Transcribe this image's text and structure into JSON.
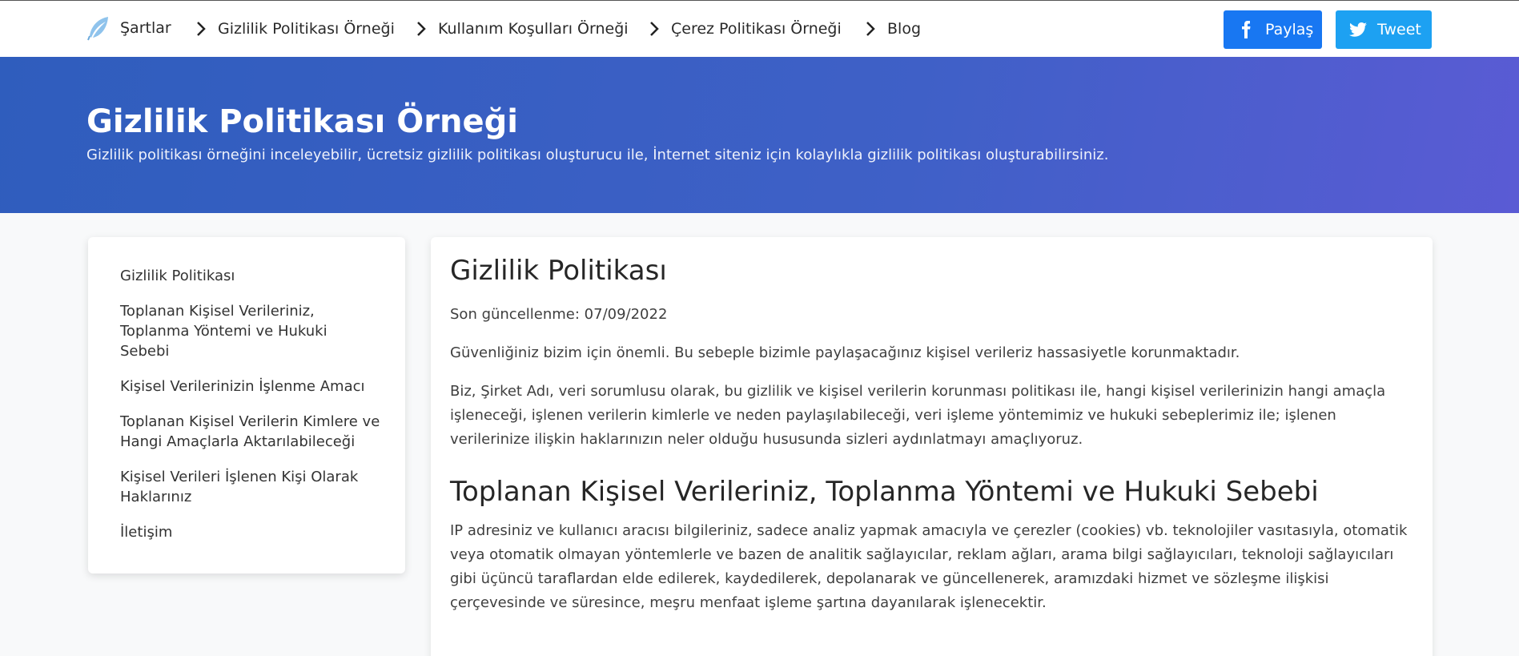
{
  "nav": {
    "brand_label": "Şartlar",
    "brand_icon": "feather-icon",
    "items": [
      {
        "label": "Gizlilik Politikası Örneği"
      },
      {
        "label": "Kullanım Koşulları Örneği"
      },
      {
        "label": "Çerez Politikası Örneği"
      },
      {
        "label": "Blog"
      }
    ],
    "share_facebook": "Paylaş",
    "share_twitter": "Tweet"
  },
  "hero": {
    "title": "Gizlilik Politikası Örneği",
    "subtitle": "Gizlilik politikası örneğini inceleyebilir, ücretsiz gizlilik politikası oluşturucu ile, İnternet siteniz için kolaylıkla gizlilik politikası oluşturabilirsiniz."
  },
  "sidebar": {
    "items": [
      {
        "label": "Gizlilik Politikası"
      },
      {
        "label": "Toplanan Kişisel Verileriniz, Toplanma Yöntemi ve Hukuki Sebebi"
      },
      {
        "label": "Kişisel Verilerinizin İşlenme Amacı"
      },
      {
        "label": "Toplanan Kişisel Verilerin Kimlere ve Hangi Amaçlarla Aktarılabileceği"
      },
      {
        "label": "Kişisel Verileri İşlenen Kişi Olarak Haklarınız"
      },
      {
        "label": "İletişim"
      }
    ]
  },
  "content": {
    "title": "Gizlilik Politikası",
    "updated": "Son güncellenme: 07/09/2022",
    "para1": "Güvenliğiniz bizim için önemli. Bu sebeple bizimle paylaşacağınız kişisel verileriz hassasiyetle korunmaktadır.",
    "para2": "Biz, Şirket Adı, veri sorumlusu olarak, bu gizlilik ve kişisel verilerin korunması politikası ile, hangi kişisel verilerinizin hangi amaçla işleneceği, işlenen verilerin kimlerle ve neden paylaşılabileceği, veri işleme yöntemimiz ve hukuki sebeplerimiz ile; işlenen verilerinize ilişkin haklarınızın neler olduğu hususunda sizleri aydınlatmayı amaçlıyoruz.",
    "section_title": "Toplanan Kişisel Verileriniz, Toplanma Yöntemi ve Hukuki Sebebi",
    "para3": "IP adresiniz ve kullanıcı aracısı bilgileriniz, sadece analiz yapmak amacıyla ve çerezler (cookies) vb. teknolojiler vasıtasıyla, otomatik veya otomatik olmayan yöntemlerle ve bazen de analitik sağlayıcılar, reklam ağları, arama bilgi sağlayıcıları, teknoloji sağlayıcıları gibi üçüncü taraflardan elde edilerek, kaydedilerek, depolanarak ve güncellenerek, aramızdaki hizmet ve sözleşme ilişkisi çerçevesinde ve süresince, meşru menfaat işleme şartına dayanılarak işlenecektir."
  },
  "colors": {
    "facebook": "#1877f2",
    "twitter": "#1da1f2",
    "hero_start": "#2f5dbd",
    "hero_end": "#5a5bd4"
  }
}
